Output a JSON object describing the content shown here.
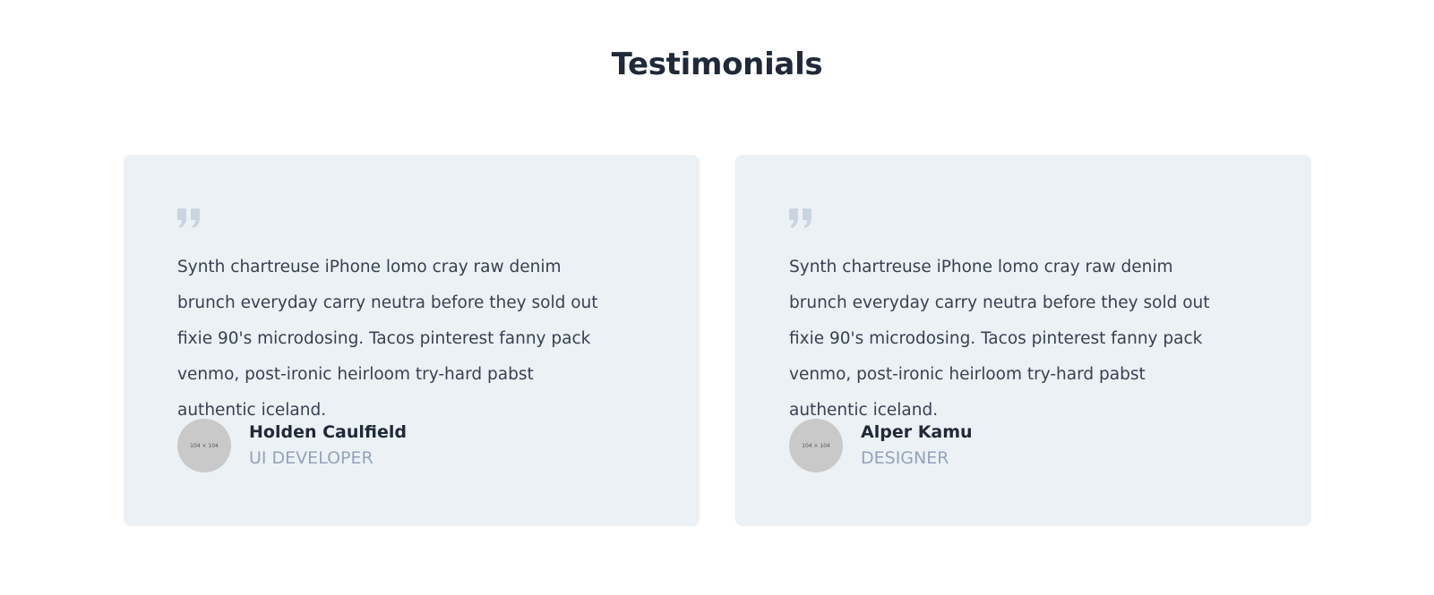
{
  "section": {
    "title": "Testimonials"
  },
  "testimonials": [
    {
      "quote": "Synth chartreuse iPhone lomo cray raw denim brunch everyday carry neutra before they sold out fixie 90's microdosing. Tacos pinterest fanny pack venmo, post-ironic heirloom try-hard pabst authentic iceland.",
      "name": "Holden Caulfield",
      "role": "UI DEVELOPER",
      "avatar_label": "104 × 104",
      "icon": "quote-icon"
    },
    {
      "quote": "Synth chartreuse iPhone lomo cray raw denim brunch everyday carry neutra before they sold out fixie 90's microdosing. Tacos pinterest fanny pack venmo, post-ironic heirloom try-hard pabst authentic iceland.",
      "name": "Alper Kamu",
      "role": "DESIGNER",
      "avatar_label": "104 × 104",
      "icon": "quote-icon"
    }
  ],
  "colors": {
    "card_background": "#ecf1f5",
    "quote_icon": "#cbd5e1",
    "role_text": "#94a3b8",
    "heading_text": "#1f2937"
  }
}
